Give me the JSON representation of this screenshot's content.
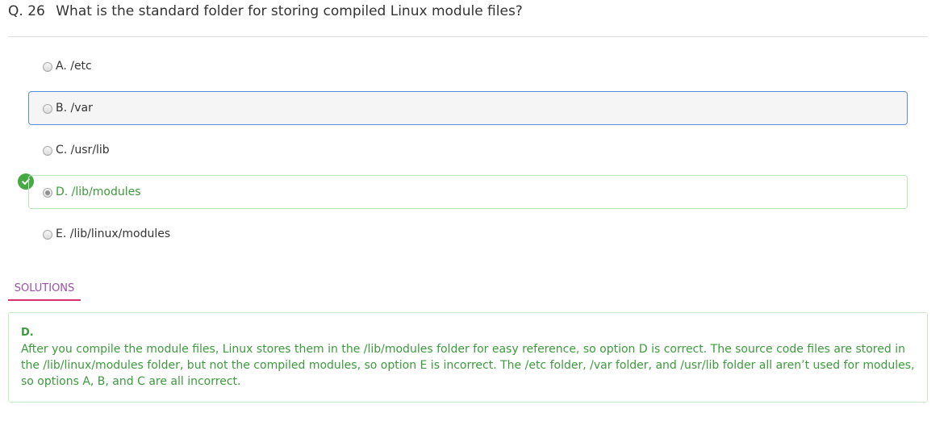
{
  "question": {
    "number": "Q. 26",
    "text": "What is the standard folder for storing compiled Linux module files?"
  },
  "options": [
    {
      "label": "A. /etc"
    },
    {
      "label": "B. /var"
    },
    {
      "label": "C. /usr/lib"
    },
    {
      "label": "D. /lib/modules"
    },
    {
      "label": "E. /lib/linux/modules"
    }
  ],
  "selected_option": "D",
  "correct_option": "D",
  "solutions": {
    "tab_label": "SOLUTIONS",
    "answer": "D.",
    "explanation": "After you compile the module files, Linux stores them in the /lib/modules folder for easy reference, so option D is correct. The source code files are stored in the /lib/linux/modules folder, but not the compiled modules, so option E is incorrect. The /etc folder, /var folder, and /usr/lib folder all aren’t used for modules, so options A, B, and C are all incorrect."
  },
  "icons": {
    "correct_marker": "check-circle-icon"
  },
  "colors": {
    "correct_green": "#46a946",
    "hover_border_blue": "#5b8fdc",
    "tab_underline": "#d6336c",
    "tab_text": "#9b4fa8"
  }
}
